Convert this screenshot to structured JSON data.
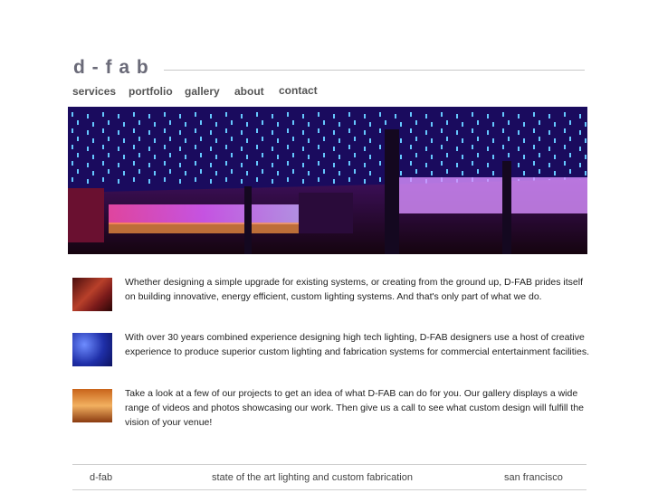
{
  "site": {
    "logo": "d - f a b"
  },
  "nav": [
    {
      "label": "services"
    },
    {
      "label": "portfolio"
    },
    {
      "label": "gallery"
    },
    {
      "label": "about"
    },
    {
      "label": "contact"
    }
  ],
  "content": [
    {
      "text": "Whether designing a simple upgrade for existing systems, or creating from the ground up, D-FAB prides itself on building innovative, energy efficient, custom lighting systems. And that's only part of what we do."
    },
    {
      "text": "With over 30 years combined experience designing high tech lighting, D-FAB designers use a host of creative experience to produce superior custom lighting and fabrication systems for commercial entertainment facilities."
    },
    {
      "text": "Take a look at a few of our projects to get an idea of what D-FAB can do for you. Our gallery displays a wide range of videos and photos showcasing our work. Then give us a call to see what custom design will fulfill the vision of your venue!"
    }
  ],
  "footer": {
    "left": "d-fab",
    "center": "state of the art lighting and custom fabrication",
    "right": "san francisco"
  },
  "colors": {
    "logo": "#6a6a78",
    "nav": "#555555",
    "rule": "#c8c8c8",
    "hero_accent": "#7a3cff"
  }
}
